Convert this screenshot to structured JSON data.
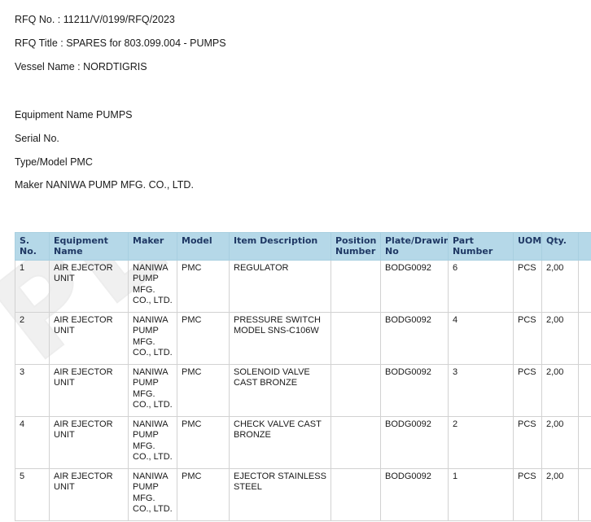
{
  "document": {
    "header_lines": [
      "RFQ No. : 11211/V/0199/RFQ/2023",
      "RFQ Title : SPARES for 803.099.004 - PUMPS",
      "Vessel Name : NORDTIGRIS"
    ],
    "equipment_lines": [
      "Equipment Name PUMPS",
      "Serial No.",
      "Type/Model PMC",
      "Maker NANIWA PUMP MFG. CO., LTD."
    ],
    "watermark": "PENDING"
  },
  "colors": {
    "header_background": "#b5d8e8",
    "header_text": "#1f3864",
    "body_text": "#1a1a1a",
    "grid_line": "#d2d2d2",
    "watermark": "#f0f0f0"
  },
  "table": {
    "columns": [
      "S. No.",
      "Equipment Name",
      "Maker",
      "Model",
      "Item Description",
      "Position Number",
      "Plate/Drawing No",
      "Part Number",
      "UOM",
      "Qty.",
      ""
    ],
    "rows": [
      {
        "sno": "1",
        "equipment_name": "AIR EJECTOR UNIT",
        "maker": "NANIWA PUMP MFG. CO., LTD.",
        "model": "PMC",
        "item_description": "REGULATOR",
        "position_number": "",
        "plate_drawing_no": "BODG0092",
        "part_number": "6",
        "uom": "PCS",
        "qty": "2,00",
        "extra": ""
      },
      {
        "sno": "2",
        "equipment_name": "AIR EJECTOR UNIT",
        "maker": "NANIWA PUMP MFG. CO., LTD.",
        "model": "PMC",
        "item_description": "PRESSURE SWITCH MODEL SNS-C106W",
        "position_number": "",
        "plate_drawing_no": "BODG0092",
        "part_number": "4",
        "uom": "PCS",
        "qty": "2,00",
        "extra": ""
      },
      {
        "sno": "3",
        "equipment_name": "AIR EJECTOR UNIT",
        "maker": "NANIWA PUMP MFG. CO., LTD.",
        "model": "PMC",
        "item_description": "SOLENOID VALVE CAST BRONZE",
        "position_number": "",
        "plate_drawing_no": "BODG0092",
        "part_number": "3",
        "uom": "PCS",
        "qty": "2,00",
        "extra": ""
      },
      {
        "sno": "4",
        "equipment_name": "AIR EJECTOR UNIT",
        "maker": "NANIWA PUMP MFG. CO., LTD.",
        "model": "PMC",
        "item_description": "CHECK VALVE CAST BRONZE",
        "position_number": "",
        "plate_drawing_no": "BODG0092",
        "part_number": "2",
        "uom": "PCS",
        "qty": "2,00",
        "extra": ""
      },
      {
        "sno": "5",
        "equipment_name": "AIR EJECTOR UNIT",
        "maker": "NANIWA PUMP MFG. CO., LTD.",
        "model": "PMC",
        "item_description": "EJECTOR STAINLESS STEEL",
        "position_number": "",
        "plate_drawing_no": "BODG0092",
        "part_number": "1",
        "uom": "PCS",
        "qty": "2,00",
        "extra": ""
      }
    ]
  }
}
